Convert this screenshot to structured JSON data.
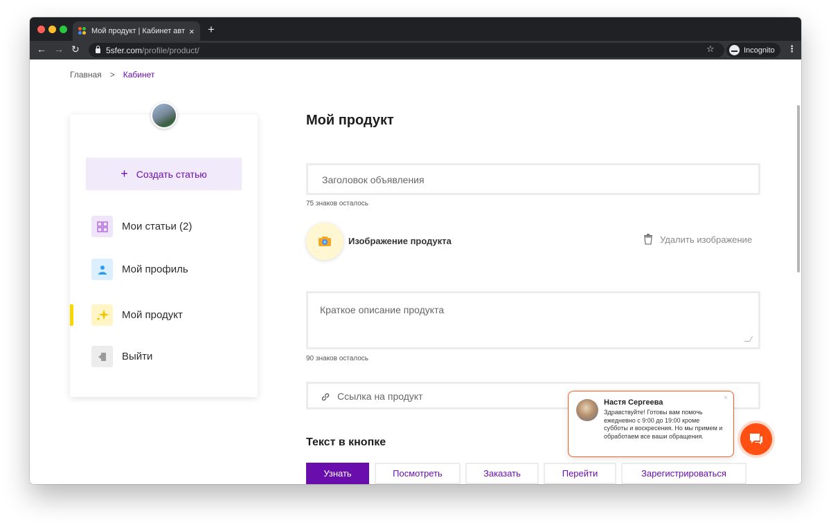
{
  "browser": {
    "tab_title": "Мой продукт | Кабинет автор",
    "tab_close": "×",
    "new_tab": "+",
    "url_host": "5sfer.com",
    "url_path": "/profile/product/",
    "incognito_label": "Incognito"
  },
  "breadcrumb": {
    "home": "Главная",
    "separator": ">",
    "current": "Кабинет"
  },
  "sidebar": {
    "create_button": "Создать статью",
    "create_icon": "+",
    "items": [
      {
        "label": "Мои статьи (2)",
        "icon": "articles-grid-icon",
        "color": "#e7d9f6"
      },
      {
        "label": "Мой профиль",
        "icon": "user-icon",
        "color": "#dcefff"
      },
      {
        "label": "Мой продукт",
        "icon": "sparkles-icon",
        "color": "#fff5c6"
      },
      {
        "label": "Выйти",
        "icon": "logout-icon",
        "color": "#ececec"
      }
    ],
    "active_index": 2
  },
  "main": {
    "title": "Мой продукт",
    "headline_placeholder": "Заголовок объявления",
    "headline_hint": "75 знаков осталось",
    "image_label": "Изображение продукта",
    "delete_image": "Удалить изображение",
    "description_placeholder": "Краткое описание продукта",
    "description_hint": "90 знаков осталось",
    "link_placeholder": "Ссылка на продукт",
    "button_text_title": "Текст в кнопке",
    "button_options": [
      "Узнать",
      "Посмотреть",
      "Заказать",
      "Перейти",
      "Зарегистрироваться"
    ]
  },
  "chat": {
    "name": "Настя Сергеева",
    "message": "Здравствуйте! Готовы вам помочь ежедневно с 9:00 до 19:00 кроме субботы и воскресения. Но мы примем и обработаем все ваши обращения.",
    "close": "×"
  },
  "colors": {
    "brand_purple": "#6a0dad",
    "accent_yellow": "#f8d800",
    "chat_orange": "#ff4f12"
  }
}
